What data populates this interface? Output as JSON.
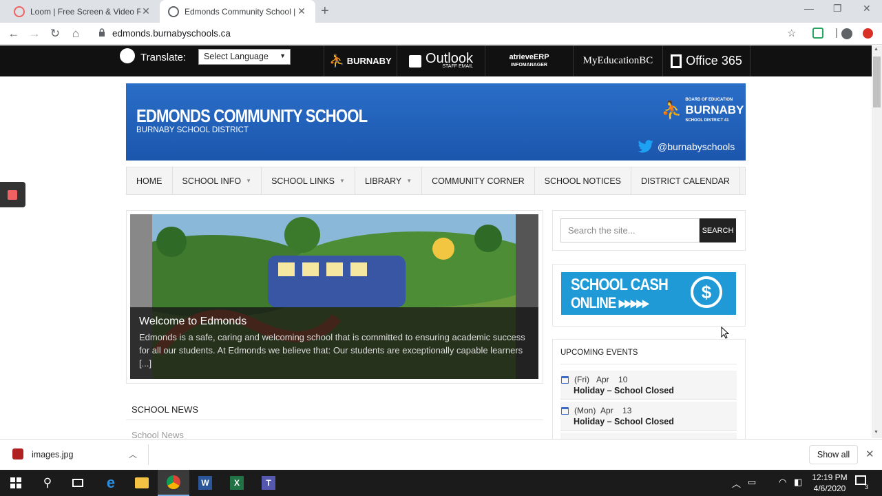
{
  "browser": {
    "tabs": [
      {
        "title": "Loom | Free Screen & Video Reco"
      },
      {
        "title": "Edmonds Community School | Bu"
      }
    ],
    "url": "edmonds.burnabyschools.ca"
  },
  "topbar": {
    "translate_label": "Translate:",
    "language_select": "Select Language",
    "links": {
      "burnaby": "BURNABY",
      "outlook": "Outlook",
      "outlook_sub": "STAFF EMAIL",
      "atrieve": "atrieveERP",
      "atrieve_sub": "INFOMANAGER",
      "myed": "MyEducationBC",
      "office": "Office 365"
    }
  },
  "banner": {
    "school_name": "EDMONDS COMMUNITY SCHOOL",
    "district": "BURNABY SCHOOL DISTRICT",
    "logo_small": "BOARD OF EDUCATION",
    "logo_main": "BURNABY",
    "logo_sub": "SCHOOL DISTRICT 41",
    "twitter": "@burnabyschools"
  },
  "menu": {
    "items": [
      {
        "label": "HOME",
        "dropdown": false
      },
      {
        "label": "SCHOOL INFO",
        "dropdown": true
      },
      {
        "label": "SCHOOL LINKS",
        "dropdown": true
      },
      {
        "label": "LIBRARY",
        "dropdown": true
      },
      {
        "label": "COMMUNITY CORNER",
        "dropdown": false
      },
      {
        "label": "SCHOOL NOTICES",
        "dropdown": false
      },
      {
        "label": "DISTRICT CALENDAR",
        "dropdown": false
      }
    ]
  },
  "slider": {
    "title": "Welcome to Edmonds",
    "text": "Edmonds is a safe, caring and welcoming school that is committed to ensuring academic success for all our students. At Edmonds we believe that: Our students are exceptionally capable learners [...]"
  },
  "news": {
    "heading": "SCHOOL NEWS",
    "link": "School News"
  },
  "sidebar": {
    "search_placeholder": "Search the site...",
    "search_button": "SEARCH",
    "cash_line1": "SCHOOL CASH",
    "cash_line2": "ONLINE ▸▸▸▸▸",
    "events_heading": "UPCOMING EVENTS",
    "events": [
      {
        "day": "(Fri)",
        "month": "Apr",
        "date": "10",
        "title": "Holiday – School Closed"
      },
      {
        "day": "(Mon)",
        "month": "Apr",
        "date": "13",
        "title": "Holiday – School Closed"
      }
    ]
  },
  "downloads": {
    "file": "images.jpg",
    "show_all": "Show all"
  },
  "taskbar": {
    "time": "12:19 PM",
    "date": "4/6/2020",
    "notification_count": "3"
  },
  "colors": {
    "banner_blue": "#1c56ad",
    "cash_blue": "#1f9ad6",
    "topbar": "#111111",
    "loom_red": "#f06262"
  }
}
